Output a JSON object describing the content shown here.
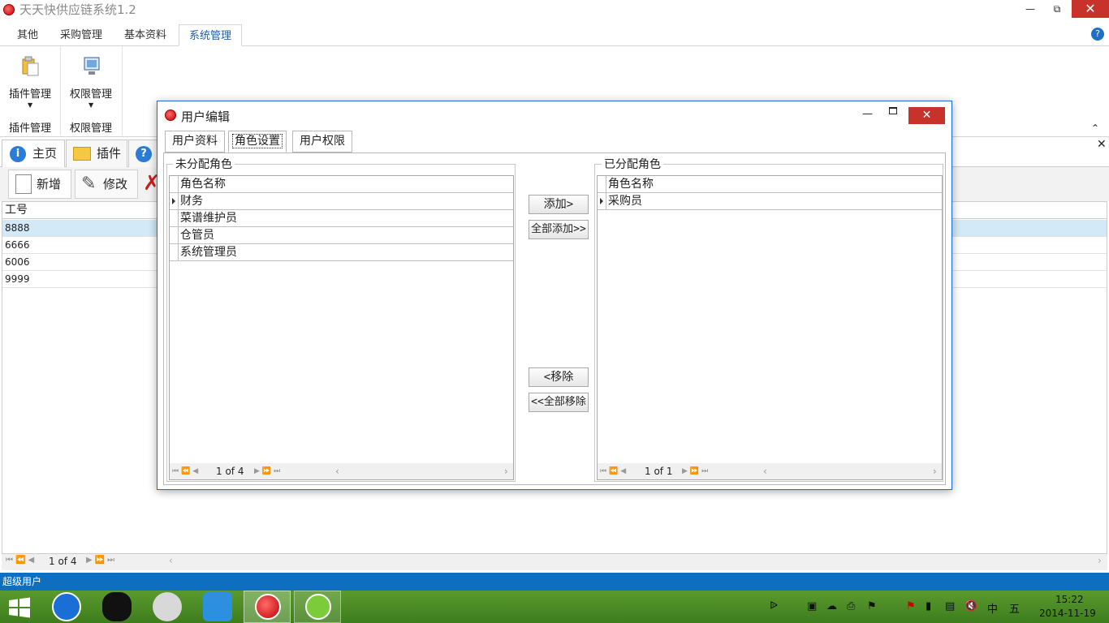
{
  "window": {
    "title": "天天快供应链系统1.2"
  },
  "ribbon": {
    "tabs": [
      "其他",
      "采购管理",
      "基本资料",
      "系统管理"
    ],
    "groups": [
      {
        "button_label": "插件管理",
        "group_label": "插件管理"
      },
      {
        "button_label": "权限管理",
        "group_label": "权限管理"
      }
    ]
  },
  "doc_tabs": [
    "主页",
    "插件"
  ],
  "toolbar": {
    "add_label": "新增",
    "edit_label": "修改"
  },
  "grid": {
    "column_header": "工号",
    "rows": [
      "8888",
      "6666",
      "6006",
      "9999"
    ],
    "pager": "1 of 4"
  },
  "status": {
    "user": "超级用户"
  },
  "dialog": {
    "title": "用户编辑",
    "tabs": [
      "用户资料",
      "角色设置",
      "用户权限"
    ],
    "unassigned": {
      "legend": "未分配角色",
      "column_header": "角色名称",
      "rows": [
        "财务",
        "菜谱维护员",
        "仓管员",
        "系统管理员"
      ],
      "pager": "1 of 4"
    },
    "assigned": {
      "legend": "已分配角色",
      "column_header": "角色名称",
      "rows": [
        "采购员"
      ],
      "pager": "1 of 1"
    },
    "buttons": {
      "add": "添加>",
      "add_all": "全部添加>>",
      "remove": "<移除",
      "remove_all": "<<全部移除"
    }
  },
  "taskbar": {
    "ime1": "中",
    "ime2": "五",
    "time": "15:22",
    "date": "2014-11-19"
  }
}
